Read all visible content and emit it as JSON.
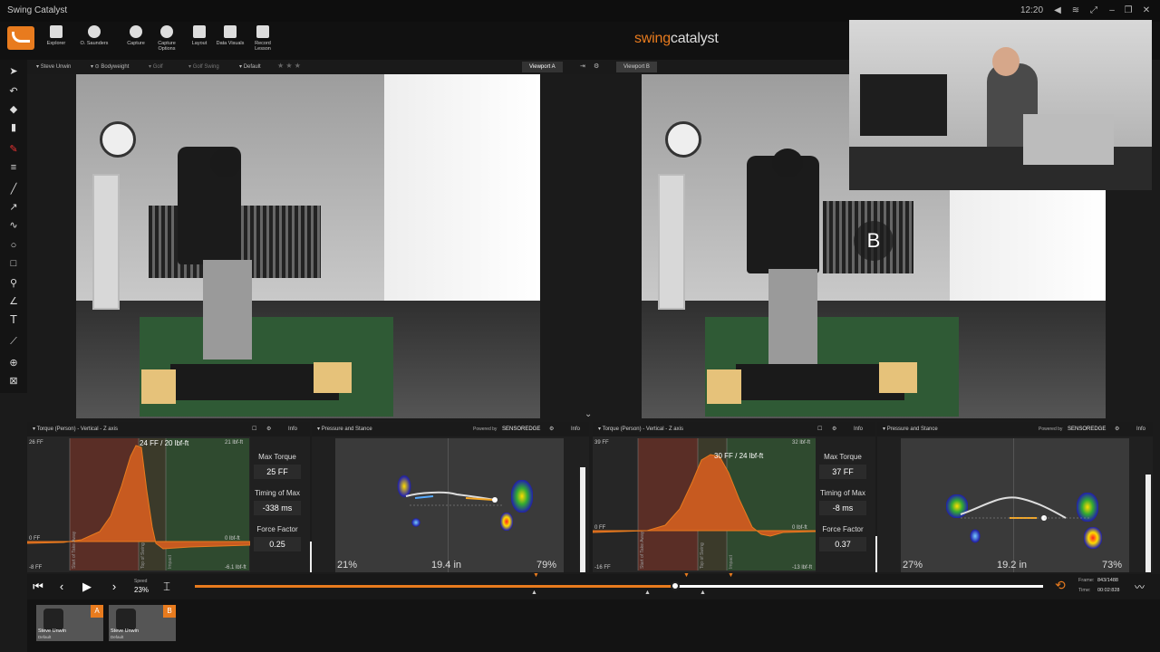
{
  "app": {
    "title": "Swing Catalyst",
    "clock": "12:20"
  },
  "toolbar": {
    "items": [
      {
        "label": "Explorer",
        "icon": "folder-icon"
      },
      {
        "label": "O. Saunders",
        "icon": "user-icon"
      },
      {
        "label": "Capture",
        "icon": "record-icon"
      },
      {
        "label": "Capture Options",
        "icon": "gear-icon"
      },
      {
        "label": "Layout",
        "icon": "grid-icon"
      },
      {
        "label": "Data Visuals",
        "icon": "chart-icon"
      },
      {
        "label": "Record Lesson",
        "icon": "lesson-icon"
      }
    ],
    "brand_prefix": "swing",
    "brand_suffix": "catalyst"
  },
  "session": {
    "player": "Steve Unwin",
    "bodyweight": "Bodyweight",
    "sport": "Golf",
    "activity": "Golf Swing",
    "preset": "Default",
    "rating": "★ ★ ★"
  },
  "viewports": {
    "a_label": "Viewport A",
    "b_label": "Viewport B",
    "b_marker": "B"
  },
  "panels": [
    {
      "title": "Torque (Person) - Vertical - Z axis",
      "info": "Info",
      "axis_top_left": "26 FF",
      "axis_top_right": "21 lbf-ft",
      "axis_zero_left": "0 FF",
      "axis_zero_right": "0 lbf-ft",
      "axis_bottom_left": "-8 FF",
      "axis_bottom_right": "-6.1 lbf-ft",
      "peak_label": "24 FF / 20 lbf-ft",
      "event_start": "Start of Take Away",
      "event_top": "Top of Swing",
      "event_impact": "Impact",
      "max_torque_label": "Max Torque",
      "max_torque_value": "25 FF",
      "timing_label": "Timing of Max",
      "timing_value": "-338 ms",
      "force_label": "Force Factor",
      "force_value": "0.25"
    },
    {
      "title": "Pressure and Stance",
      "powered_by": "Powered by",
      "sensor_brand": "SENSOREDGE",
      "info": "Info",
      "left_pct": "21%",
      "stance": "19.4 in",
      "right_pct": "79%"
    },
    {
      "title": "Torque (Person) - Vertical - Z axis",
      "info": "Info",
      "axis_top_left": "39 FF",
      "axis_top_right": "32 lbf-ft",
      "axis_zero_left": "0 FF",
      "axis_zero_right": "0 lbf-ft",
      "axis_bottom_left": "-16 FF",
      "axis_bottom_right": "-13 lbf-ft",
      "peak_label": "30 FF / 24 lbf-ft",
      "event_start": "Start of Take Away",
      "event_top": "Top of Swing",
      "event_impact": "Impact",
      "max_torque_label": "Max Torque",
      "max_torque_value": "37 FF",
      "timing_label": "Timing of Max",
      "timing_value": "-8 ms",
      "force_label": "Force Factor",
      "force_value": "0.37"
    },
    {
      "title": "Pressure and Stance",
      "powered_by": "Powered by",
      "sensor_brand": "SENSOREDGE",
      "info": "Info",
      "left_pct": "27%",
      "stance": "19.2 in",
      "right_pct": "73%"
    }
  ],
  "playback": {
    "speed_label": "Speed",
    "speed_value": "23%",
    "frame_label": "Frame:",
    "frame_value": "843/1488",
    "time_label": "Time:",
    "time_value": "00:02:828",
    "progress": 0.566
  },
  "recordings": [
    {
      "name": "Steve Unwin",
      "sub": "Default",
      "badge": "A"
    },
    {
      "name": "Steve Unwin",
      "sub": "Default",
      "badge": "B"
    }
  ],
  "colors": {
    "accent": "#e87b1e",
    "chart_red_zone": "#5a2e26",
    "chart_green_zone": "#2f4a2f"
  }
}
